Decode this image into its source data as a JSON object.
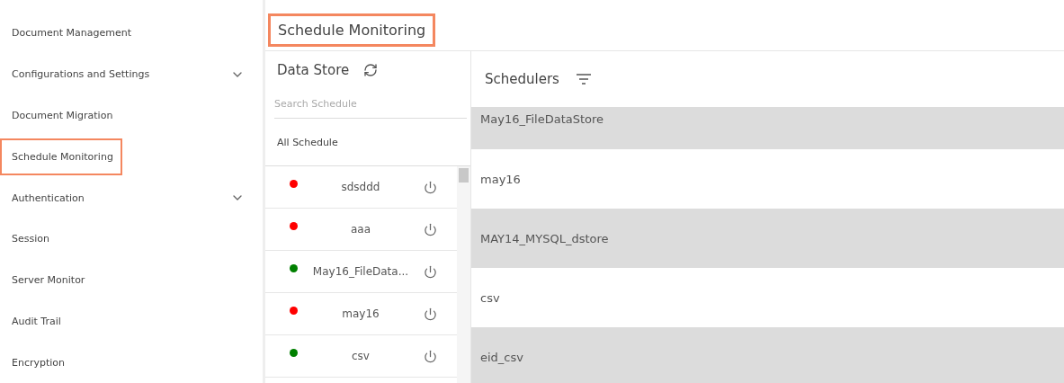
{
  "sidebar": {
    "items": [
      {
        "label": "Document Management",
        "expandable": false,
        "selected": false
      },
      {
        "label": "Configurations and Settings",
        "expandable": true,
        "selected": false
      },
      {
        "label": "Document Migration",
        "expandable": false,
        "selected": false
      },
      {
        "label": "Schedule Monitoring",
        "expandable": false,
        "selected": true
      },
      {
        "label": "Authentication",
        "expandable": true,
        "selected": false
      },
      {
        "label": "Session",
        "expandable": false,
        "selected": false
      },
      {
        "label": "Server Monitor",
        "expandable": false,
        "selected": false
      },
      {
        "label": "Audit Trail",
        "expandable": false,
        "selected": false
      },
      {
        "label": "Encryption",
        "expandable": false,
        "selected": false
      }
    ]
  },
  "page_title": {
    "text": "Schedule Monitoring",
    "highlighted": true
  },
  "data_store": {
    "title": "Data Store",
    "search": {
      "placeholder": "Search Schedule"
    },
    "filter_label": "All Schedule",
    "items": [
      {
        "name": "sdsddd",
        "color": "#ff0000"
      },
      {
        "name": "aaa",
        "color": "#ff0000"
      },
      {
        "name": "May16_FileData...",
        "color": "#008000"
      },
      {
        "name": "may16",
        "color": "#ff0000"
      },
      {
        "name": "csv",
        "color": "#008000"
      }
    ]
  },
  "schedulers": {
    "title": "Schedulers",
    "rows": [
      {
        "name": "May16_FileDataStore",
        "shaded": true
      },
      {
        "name": "may16",
        "shaded": false
      },
      {
        "name": "MAY14_MYSQL_dstore",
        "shaded": true
      },
      {
        "name": "csv",
        "shaded": false
      },
      {
        "name": "eid_csv",
        "shaded": true
      }
    ]
  }
}
